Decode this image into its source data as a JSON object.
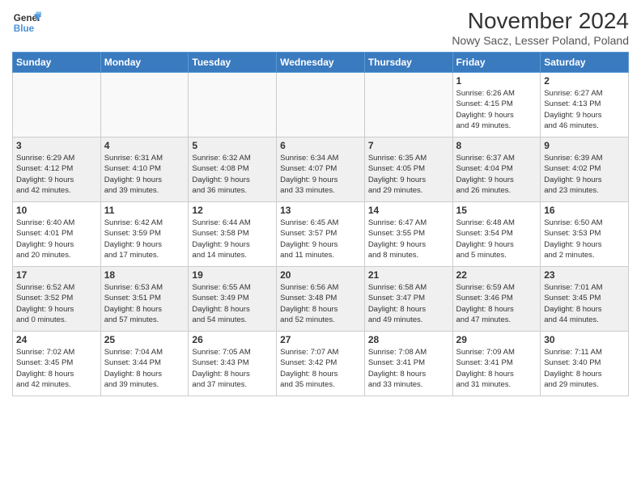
{
  "logo": {
    "line1": "General",
    "line2": "Blue"
  },
  "title": "November 2024",
  "subtitle": "Nowy Sacz, Lesser Poland, Poland",
  "headers": [
    "Sunday",
    "Monday",
    "Tuesday",
    "Wednesday",
    "Thursday",
    "Friday",
    "Saturday"
  ],
  "weeks": [
    [
      {
        "day": "",
        "info": "",
        "empty": true
      },
      {
        "day": "",
        "info": "",
        "empty": true
      },
      {
        "day": "",
        "info": "",
        "empty": true
      },
      {
        "day": "",
        "info": "",
        "empty": true
      },
      {
        "day": "",
        "info": "",
        "empty": true
      },
      {
        "day": "1",
        "info": "Sunrise: 6:26 AM\nSunset: 4:15 PM\nDaylight: 9 hours\nand 49 minutes."
      },
      {
        "day": "2",
        "info": "Sunrise: 6:27 AM\nSunset: 4:13 PM\nDaylight: 9 hours\nand 46 minutes."
      }
    ],
    [
      {
        "day": "3",
        "info": "Sunrise: 6:29 AM\nSunset: 4:12 PM\nDaylight: 9 hours\nand 42 minutes."
      },
      {
        "day": "4",
        "info": "Sunrise: 6:31 AM\nSunset: 4:10 PM\nDaylight: 9 hours\nand 39 minutes."
      },
      {
        "day": "5",
        "info": "Sunrise: 6:32 AM\nSunset: 4:08 PM\nDaylight: 9 hours\nand 36 minutes."
      },
      {
        "day": "6",
        "info": "Sunrise: 6:34 AM\nSunset: 4:07 PM\nDaylight: 9 hours\nand 33 minutes."
      },
      {
        "day": "7",
        "info": "Sunrise: 6:35 AM\nSunset: 4:05 PM\nDaylight: 9 hours\nand 29 minutes."
      },
      {
        "day": "8",
        "info": "Sunrise: 6:37 AM\nSunset: 4:04 PM\nDaylight: 9 hours\nand 26 minutes."
      },
      {
        "day": "9",
        "info": "Sunrise: 6:39 AM\nSunset: 4:02 PM\nDaylight: 9 hours\nand 23 minutes."
      }
    ],
    [
      {
        "day": "10",
        "info": "Sunrise: 6:40 AM\nSunset: 4:01 PM\nDaylight: 9 hours\nand 20 minutes."
      },
      {
        "day": "11",
        "info": "Sunrise: 6:42 AM\nSunset: 3:59 PM\nDaylight: 9 hours\nand 17 minutes."
      },
      {
        "day": "12",
        "info": "Sunrise: 6:44 AM\nSunset: 3:58 PM\nDaylight: 9 hours\nand 14 minutes."
      },
      {
        "day": "13",
        "info": "Sunrise: 6:45 AM\nSunset: 3:57 PM\nDaylight: 9 hours\nand 11 minutes."
      },
      {
        "day": "14",
        "info": "Sunrise: 6:47 AM\nSunset: 3:55 PM\nDaylight: 9 hours\nand 8 minutes."
      },
      {
        "day": "15",
        "info": "Sunrise: 6:48 AM\nSunset: 3:54 PM\nDaylight: 9 hours\nand 5 minutes."
      },
      {
        "day": "16",
        "info": "Sunrise: 6:50 AM\nSunset: 3:53 PM\nDaylight: 9 hours\nand 2 minutes."
      }
    ],
    [
      {
        "day": "17",
        "info": "Sunrise: 6:52 AM\nSunset: 3:52 PM\nDaylight: 9 hours\nand 0 minutes."
      },
      {
        "day": "18",
        "info": "Sunrise: 6:53 AM\nSunset: 3:51 PM\nDaylight: 8 hours\nand 57 minutes."
      },
      {
        "day": "19",
        "info": "Sunrise: 6:55 AM\nSunset: 3:49 PM\nDaylight: 8 hours\nand 54 minutes."
      },
      {
        "day": "20",
        "info": "Sunrise: 6:56 AM\nSunset: 3:48 PM\nDaylight: 8 hours\nand 52 minutes."
      },
      {
        "day": "21",
        "info": "Sunrise: 6:58 AM\nSunset: 3:47 PM\nDaylight: 8 hours\nand 49 minutes."
      },
      {
        "day": "22",
        "info": "Sunrise: 6:59 AM\nSunset: 3:46 PM\nDaylight: 8 hours\nand 47 minutes."
      },
      {
        "day": "23",
        "info": "Sunrise: 7:01 AM\nSunset: 3:45 PM\nDaylight: 8 hours\nand 44 minutes."
      }
    ],
    [
      {
        "day": "24",
        "info": "Sunrise: 7:02 AM\nSunset: 3:45 PM\nDaylight: 8 hours\nand 42 minutes."
      },
      {
        "day": "25",
        "info": "Sunrise: 7:04 AM\nSunset: 3:44 PM\nDaylight: 8 hours\nand 39 minutes."
      },
      {
        "day": "26",
        "info": "Sunrise: 7:05 AM\nSunset: 3:43 PM\nDaylight: 8 hours\nand 37 minutes."
      },
      {
        "day": "27",
        "info": "Sunrise: 7:07 AM\nSunset: 3:42 PM\nDaylight: 8 hours\nand 35 minutes."
      },
      {
        "day": "28",
        "info": "Sunrise: 7:08 AM\nSunset: 3:41 PM\nDaylight: 8 hours\nand 33 minutes."
      },
      {
        "day": "29",
        "info": "Sunrise: 7:09 AM\nSunset: 3:41 PM\nDaylight: 8 hours\nand 31 minutes."
      },
      {
        "day": "30",
        "info": "Sunrise: 7:11 AM\nSunset: 3:40 PM\nDaylight: 8 hours\nand 29 minutes."
      }
    ]
  ]
}
